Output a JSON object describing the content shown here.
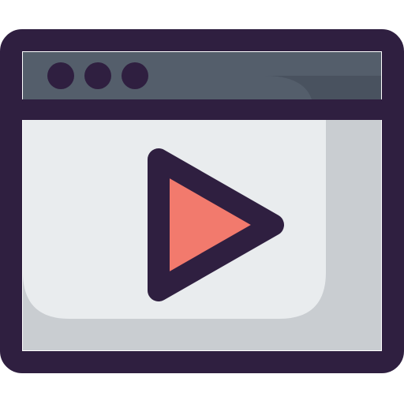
{
  "icon": {
    "name": "video-player-window-icon",
    "colors": {
      "outline": "#2f1f40",
      "titlebar_dark": "#49525f",
      "titlebar_light": "#545e6b",
      "content_bg": "#c9cdd1",
      "content_highlight": "#e9ecee",
      "play_fill": "#f27a6d",
      "background": "#ffffff"
    },
    "window_dots": 3
  }
}
